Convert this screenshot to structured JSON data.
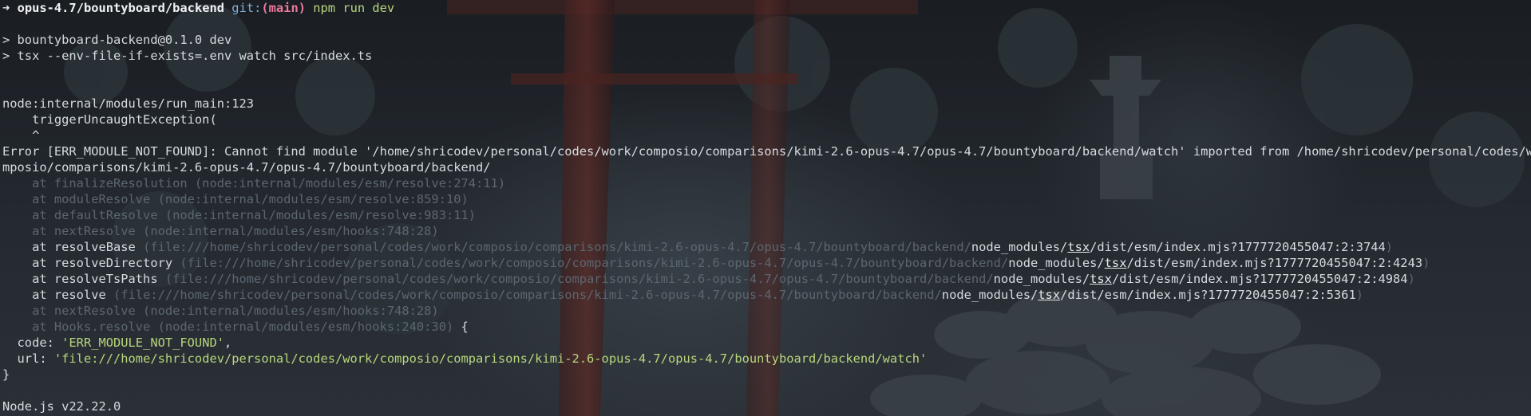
{
  "prompt": {
    "arrow": "➜",
    "path": "opus-4.7/bountyboard/backend",
    "git_label": "git:",
    "branch": "(main)",
    "command": "npm run dev"
  },
  "npm_lines": [
    "> bountyboard-backend@0.1.0 dev",
    "> tsx --env-file-if-exists=.env watch src/index.ts"
  ],
  "node_header": "node:internal/modules/run_main:123",
  "trigger_line": "    triggerUncaughtException(",
  "caret_line": "    ^",
  "error_line1": "Error [ERR_MODULE_NOT_FOUND]: Cannot find module '/home/shricodev/personal/codes/work/composio/comparisons/kimi-2.6-opus-4.7/opus-4.7/bountyboard/backend/watch' imported from /home/shricodev/personal/codes/work/co",
  "error_line2": "mposio/comparisons/kimi-2.6-opus-4.7/opus-4.7/bountyboard/backend/",
  "stack_dim_top": [
    "    at finalizeResolution (node:internal/modules/esm/resolve:274:11)",
    "    at moduleResolve (node:internal/modules/esm/resolve:859:10)",
    "    at defaultResolve (node:internal/modules/esm/resolve:983:11)",
    "    at nextResolve (node:internal/modules/esm/hooks:748:28)"
  ],
  "stack_tsx": [
    {
      "fn": "    at resolveBase ",
      "path": "(file:///home/shricodev/personal/codes/work/composio/comparisons/kimi-2.6-opus-4.7/opus-4.7/bountyboard/backend/",
      "pre": "node_modules/",
      "pkg": "tsx",
      "post": "/dist/esm/index.mjs?1777720455047:2:3744",
      "close": ")"
    },
    {
      "fn": "    at resolveDirectory ",
      "path": "(file:///home/shricodev/personal/codes/work/composio/comparisons/kimi-2.6-opus-4.7/opus-4.7/bountyboard/backend/",
      "pre": "node_modules/",
      "pkg": "tsx",
      "post": "/dist/esm/index.mjs?1777720455047:2:4243",
      "close": ")"
    },
    {
      "fn": "    at resolveTsPaths ",
      "path": "(file:///home/shricodev/personal/codes/work/composio/comparisons/kimi-2.6-opus-4.7/opus-4.7/bountyboard/backend/",
      "pre": "node_modules/",
      "pkg": "tsx",
      "post": "/dist/esm/index.mjs?1777720455047:2:4984",
      "close": ")"
    },
    {
      "fn": "    at resolve ",
      "path": "(file:///home/shricodev/personal/codes/work/composio/comparisons/kimi-2.6-opus-4.7/opus-4.7/bountyboard/backend/",
      "pre": "node_modules/",
      "pkg": "tsx",
      "post": "/dist/esm/index.mjs?1777720455047:2:5361",
      "close": ")"
    }
  ],
  "stack_dim_bottom": [
    "    at nextResolve (node:internal/modules/esm/hooks:748:28)",
    "    at Hooks.resolve (node:internal/modules/esm/hooks:240:30)"
  ],
  "brace_open": " {",
  "code_key": "  code: ",
  "code_value": "'ERR_MODULE_NOT_FOUND'",
  "code_comma": ",",
  "url_key": "  url: ",
  "url_value": "'file:///home/shricodev/personal/codes/work/composio/comparisons/kimi-2.6-opus-4.7/opus-4.7/bountyboard/backend/watch'",
  "brace_close": "}",
  "node_version": "Node.js v22.22.0",
  "colors": {
    "background": "#1d2126",
    "text": "#d6dbe0",
    "dim": "#5c6670",
    "string_green": "#b8d67c",
    "branch_pink": "#e87a9c",
    "git_blue": "#7fb1d9"
  }
}
